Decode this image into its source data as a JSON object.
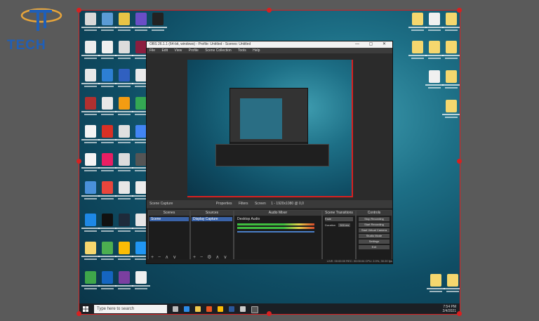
{
  "logo": {
    "text": "TECH",
    "color": "#1f5fb8"
  },
  "obs": {
    "title": "OBS 26.1.1 (64-bit, windows) - Profile: Untitled - Scenes: Untitled",
    "menu": [
      "File",
      "Edit",
      "View",
      "Profile",
      "Scene Collection",
      "Tools",
      "Help"
    ],
    "toolbar": {
      "scene_label": "Scene Capture",
      "properties": "Properties",
      "filters": "Filters",
      "screen_label": "Screen",
      "screen_value": "1 - 1920x1080 @ 0,0"
    },
    "docks": {
      "scenes": {
        "header": "Scenes",
        "items": [
          "Scene"
        ]
      },
      "sources": {
        "header": "Sources",
        "items": [
          "Display Capture"
        ]
      },
      "mixer": {
        "header": "Audio Mixer",
        "channel": "Desktop Audio"
      },
      "transitions": {
        "header": "Scene Transitions",
        "fade": "Fade",
        "duration_label": "Duration",
        "duration_value": "300 ms"
      },
      "controls": {
        "header": "Controls",
        "buttons": [
          "Stop Recording",
          "Start Recording",
          "Start Virtual Camera",
          "Studio Mode",
          "Settings",
          "Exit"
        ]
      }
    },
    "status": "LIVE: 00:00:00   REC: 00:00:04   CPU: 2.0%, 30.00 fps"
  },
  "taskbar": {
    "search_placeholder": "Type here to search",
    "time": "7:54 PM",
    "date": "2/4/2021"
  },
  "colors": {
    "selection": "#d82020",
    "obs_bg": "#2b2b2b",
    "taskbar": "#1b1f24",
    "wallpaper": "#1d6f86"
  }
}
